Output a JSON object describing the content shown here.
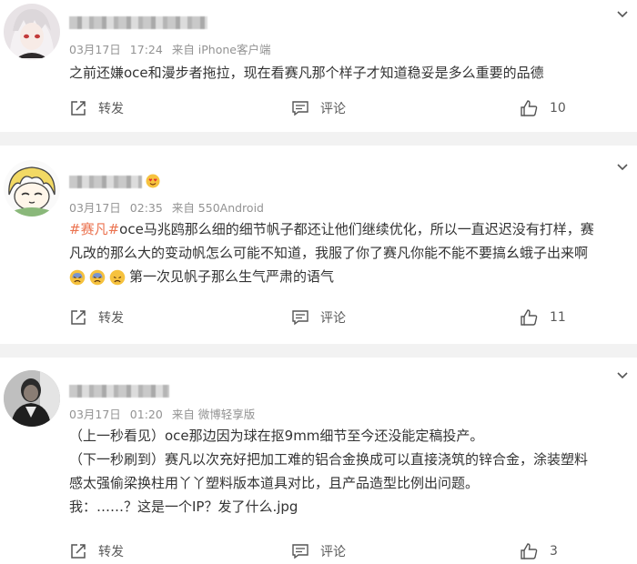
{
  "posts": [
    {
      "date": "03月17日",
      "time": "17:24",
      "source": "来自 iPhone客户端",
      "content_lines": [
        "之前还嫌oce和漫步者拖拉，现在看赛凡那个样子才知道稳妥是多么重要的品德"
      ],
      "repost_label": "转发",
      "comment_label": "评论",
      "likes": "10"
    },
    {
      "date": "03月17日",
      "time": "02:35",
      "source": "来自 550Android",
      "hashtag": "#赛凡#",
      "content_line1_rest": "oce马兆鸥那么细的细节帆子都还让他们继续优化，所以一直迟迟没有打样，赛",
      "content_line2": "凡改的那么大的变动帆怎么可能不知道，我服了你了赛凡你能不能不要搞幺蛾子出来啊",
      "content_line3": "第一次见帆子那么生气严肃的语气",
      "repost_label": "转发",
      "comment_label": "评论",
      "likes": "11"
    },
    {
      "date": "03月17日",
      "time": "01:20",
      "source": "来自 微博轻享版",
      "content_lines": [
        "（上一秒看见）oce那边因为球在抠9mm细节至今还没能定稿投产。",
        "（下一秒刷到）赛凡以次充好把加工难的铝合金换成可以直接浇筑的锌合金，涂装塑料",
        "感太强偷梁换柱用丫丫塑料版本道具对比，且产品造型比例出问题。",
        "我：……？这是一个IP？发了什么.jpg"
      ],
      "repost_label": "转发",
      "comment_label": "评论",
      "likes": "3"
    }
  ],
  "icons": [
    "chevron-down-icon",
    "repost-icon",
    "comment-icon",
    "thumbs-up-icon",
    "sad-emoji-icon",
    "heart-eyes-badge-icon"
  ],
  "colors": {
    "hashtag": "#eb7350",
    "meta": "#939393",
    "separator": "#f2f2f2",
    "text": "#333333"
  }
}
